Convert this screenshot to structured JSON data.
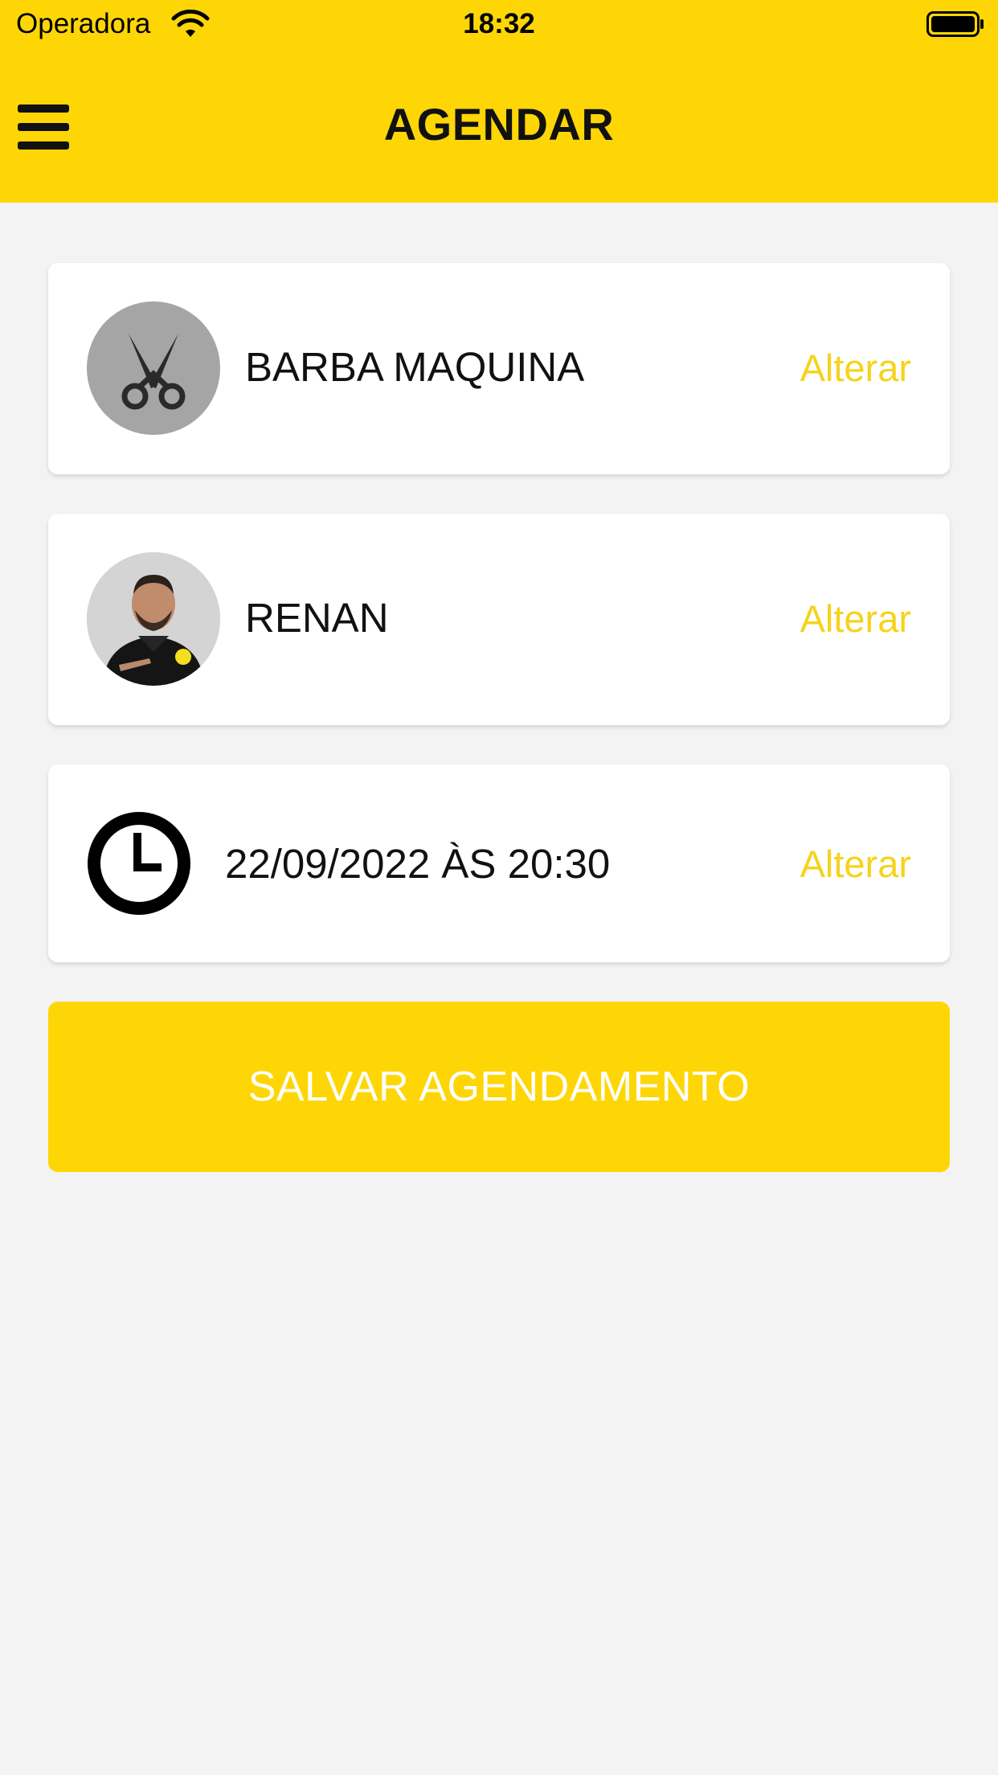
{
  "status_bar": {
    "carrier": "Operadora",
    "time": "18:32"
  },
  "header": {
    "title": "AGENDAR"
  },
  "selections": [
    {
      "label": "BARBA MAQUINA",
      "action": "Alterar",
      "icon": "scissors-icon"
    },
    {
      "label": "RENAN",
      "action": "Alterar",
      "icon": "barber-photo"
    },
    {
      "label": "22/09/2022 ÀS 20:30",
      "action": "Alterar",
      "icon": "clock-icon"
    }
  ],
  "save_button": {
    "label": "SALVAR AGENDAMENTO"
  },
  "colors": {
    "accent": "#fed605",
    "link": "#f6d31c",
    "background": "#f3f3f3"
  }
}
